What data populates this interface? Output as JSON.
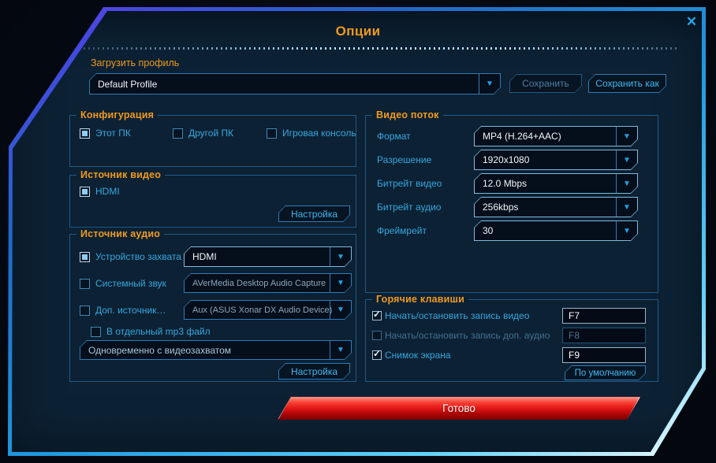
{
  "window": {
    "title": "Опции"
  },
  "icons": {
    "close": "✕",
    "dropdown_arrow": "▼",
    "check": "✓"
  },
  "colors": {
    "accent_orange": "#f09a1c",
    "accent_cyan": "#35a8e0",
    "dialog_background": "#0c2133",
    "done_button_red": "#e01414"
  },
  "profile": {
    "label": "Загрузить профиль",
    "value": "Default Profile",
    "save_label": "Сохранить",
    "save_as_label": "Сохранить как"
  },
  "configuration": {
    "title": "Конфигурация",
    "options": [
      {
        "label": "Этот ПК",
        "checked": true
      },
      {
        "label": "Другой ПК",
        "checked": false
      },
      {
        "label": "Игровая консоль",
        "checked": false
      }
    ]
  },
  "video_source": {
    "title": "Источник видео",
    "hdmi": {
      "label": "HDMI",
      "checked": true
    },
    "settings_label": "Настройка"
  },
  "audio_source": {
    "title": "Источник аудио",
    "rows": [
      {
        "label": "Устройство захвата",
        "checked": true,
        "value": "HDMI"
      },
      {
        "label": "Системный звук",
        "checked": false,
        "value": "AVerMedia Desktop Audio Capture"
      },
      {
        "label": "Доп. источник…",
        "checked": false,
        "value": "Aux (ASUS Xonar DX Audio Device)"
      }
    ],
    "mp3": {
      "label": "В отдельный mp3 файл",
      "checked": false
    },
    "mode_value": "Одновременно с видеозахватом",
    "settings_label": "Настройка"
  },
  "video_stream": {
    "title": "Видео поток",
    "rows": [
      {
        "label": "Формат",
        "value": "MP4 (H.264+AAC)"
      },
      {
        "label": "Разрешение",
        "value": "1920x1080"
      },
      {
        "label": "Битрейт видео",
        "value": "12.0 Mbps"
      },
      {
        "label": "Битрейт аудио",
        "value": "256kbps"
      },
      {
        "label": "Фреймрейт",
        "value": "30"
      }
    ]
  },
  "hotkeys": {
    "title": "Горячие клавиши",
    "rows": [
      {
        "label": "Начать/остановить запись видео",
        "checked": true,
        "key": "F7"
      },
      {
        "label": "Начать/остановить запись доп. аудио",
        "checked": false,
        "key": "F8"
      },
      {
        "label": "Снимок экрана",
        "checked": true,
        "key": "F9"
      }
    ],
    "default_label": "По умолчанию"
  },
  "footer": {
    "done_label": "Готово"
  }
}
